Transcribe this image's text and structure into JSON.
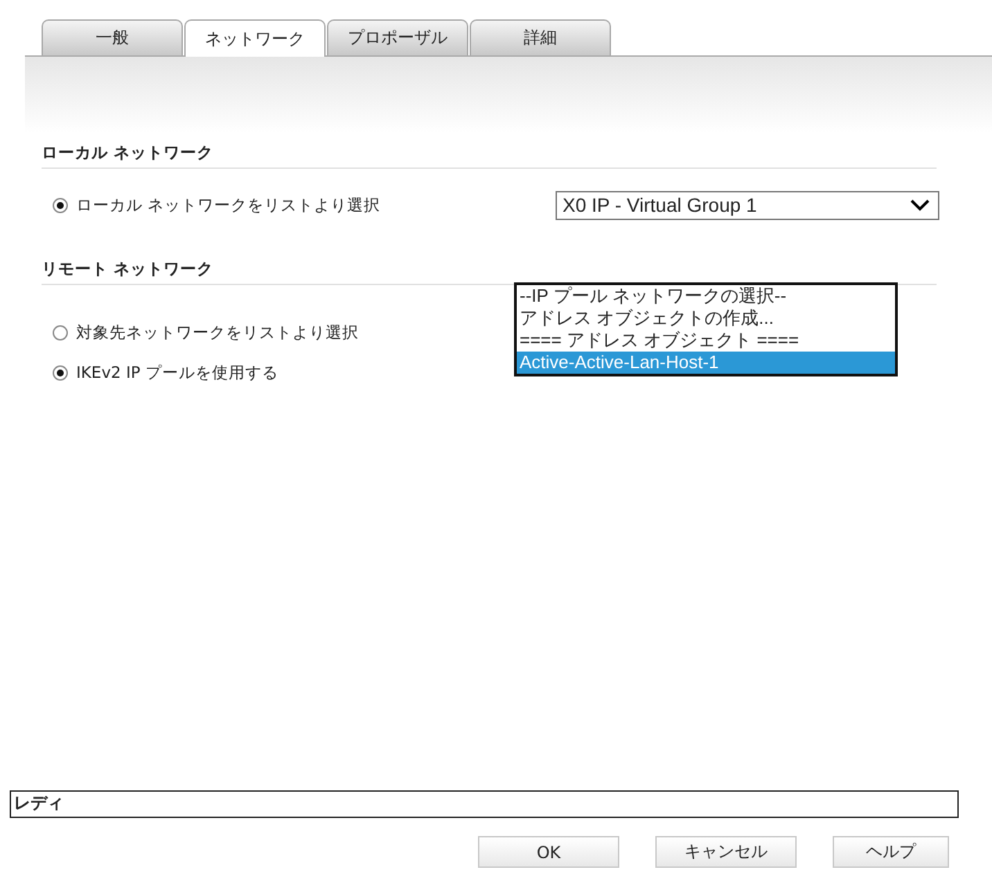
{
  "tabs": [
    {
      "label": "一般",
      "selected": false
    },
    {
      "label": "ネットワーク",
      "selected": true
    },
    {
      "label": "プロポーザル",
      "selected": false
    },
    {
      "label": "詳細",
      "selected": false
    }
  ],
  "local_network": {
    "heading": "ローカル ネットワーク",
    "options": [
      {
        "label": "ローカル ネットワークをリストより選択",
        "selected": true
      }
    ],
    "select": {
      "value": "X0 IP - Virtual Group 1"
    }
  },
  "remote_network": {
    "heading": "リモート ネットワーク",
    "options": [
      {
        "label": "対象先ネットワークをリストより選択",
        "selected": false
      },
      {
        "label": "IKEv2 IP プールを使用する",
        "selected": true
      }
    ],
    "dropdown_list": [
      {
        "label": "--IP プール ネットワークの選択--",
        "selected": false
      },
      {
        "label": "アドレス オブジェクトの作成...",
        "selected": false
      },
      {
        "label": "==== アドレス オブジェクト ====",
        "selected": false
      },
      {
        "label": "Active-Active-Lan-Host-1",
        "selected": true
      }
    ]
  },
  "status_bar": "レディ",
  "buttons": [
    "OK",
    "キャンセル",
    "ヘルプ"
  ]
}
